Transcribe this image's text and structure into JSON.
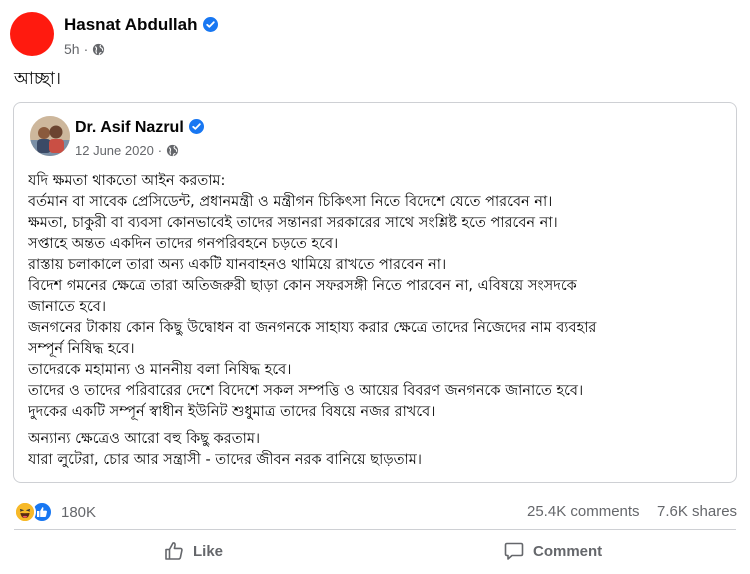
{
  "post": {
    "author": "Hasnat Abdullah",
    "time": "5h",
    "separator": "·",
    "text": "আচ্ছা।"
  },
  "shared": {
    "author": "Dr. Asif Nazrul",
    "date": "12 June 2020",
    "separator": "·",
    "lines": [
      "যদি ক্ষমতা থাকতো আইন করতাম:",
      "বর্তমান বা সাবেক প্রেসিডেন্ট, প্রধানমন্ত্রী ও মন্ত্রীগন চিকিৎসা নিতে বিদেশে যেতে পারবেন না।",
      "ক্ষমতা, চাকুরী বা ব্যবসা কোনভাবেই তাদের সন্তানরা সরকারের সাথে সংশ্লিষ্ট হতে পারবেন না।",
      "সপ্তাহে অন্তত একদিন তাদের গনপরিবহনে চড়তে হবে।",
      "রাস্তায় চলাকালে তারা অন্য একটি যানবাহনও থামিয়ে রাখতে পারবেন না।",
      "বিদেশ গমনের ক্ষেত্রে তারা অতিজরুরী ছাড়া কোন সফরসঙ্গী নিতে পারবেন না, এবিষয়ে সংসদকে",
      "জানাতে হবে।",
      "জনগনের টাকায় কোন কিছু উদ্বোধন বা জনগনকে সাহায্য করার ক্ষেত্রে তাদের নিজেদের নাম ব্যবহার",
      "সম্পূর্ন নিষিদ্ধ হবে।",
      "তাদেরকে মহামান্য ও মাননীয় বলা নিষিদ্ধ হবে।",
      "তাদের ও তাদের পরিবারের দেশে বিদেশে সকল সম্পত্তি ও আয়ের বিবরণ জনগনকে জানাতে হবে।",
      "দুদকের একটি সম্পূর্ন স্বাধীন ইউনিট শুধুমাত্র তাদের বিষয়ে নজর রাখবে।"
    ],
    "lines2": [
      "অন্যান্য ক্ষেত্রেও আরো বহু কিছু করতাম।",
      "যারা লুটেরা, চোর আর সন্ত্রাসী - তাদের জীবন নরক বানিয়ে ছাড়তাম।"
    ]
  },
  "stats": {
    "reactions": "180K",
    "comments": "25.4K comments",
    "shares": "7.6K shares"
  },
  "actions": {
    "like": "Like",
    "comment": "Comment"
  },
  "colors": {
    "accent": "#1877f2",
    "avatar": "#ff1a0f",
    "muted": "#65676b"
  },
  "icons": [
    "verified-badge-icon",
    "globe-icon",
    "haha-reaction-icon",
    "like-reaction-icon",
    "thumbs-up-icon",
    "comment-bubble-icon"
  ]
}
